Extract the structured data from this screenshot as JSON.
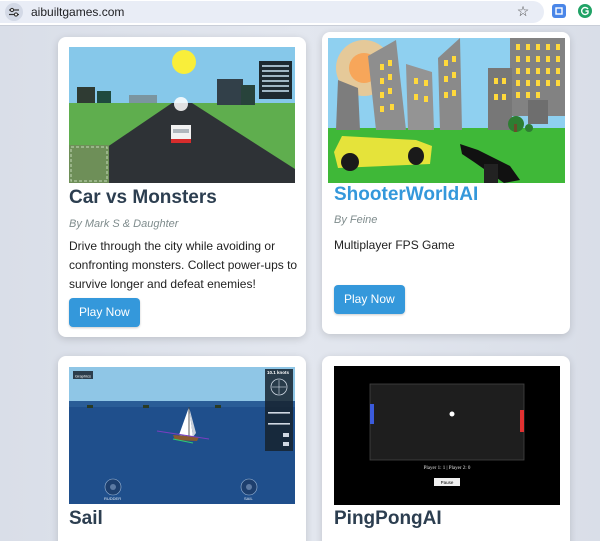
{
  "browser": {
    "url": "aibuiltgames.com",
    "site_icon": "site-settings-icon",
    "bookmark_icon": "star-icon"
  },
  "games": [
    {
      "title": "Car vs Monsters",
      "author": "By Mark S & Daughter",
      "description": "Drive through the city while avoiding or confronting monsters. Collect power-ups to survive longer and defeat enemies!",
      "play_label": "Play Now"
    },
    {
      "title": "ShooterWorldAI",
      "author": "By Feine",
      "description": "Multiplayer FPS Game",
      "play_label": "Play Now"
    },
    {
      "title": "Sail",
      "thumb": {
        "menu_label": "Graphics",
        "speed": "10.1 knots",
        "rudder_label": "RUDDER",
        "sail_label": "SAIL"
      }
    },
    {
      "title": "PingPongAI",
      "thumb": {
        "score": "Player 1: 1 | Player 2: 0",
        "button_label": "Pause"
      }
    }
  ],
  "colors": {
    "accent": "#3498db",
    "title": "#2c3e50",
    "author": "#7f8c8d"
  }
}
